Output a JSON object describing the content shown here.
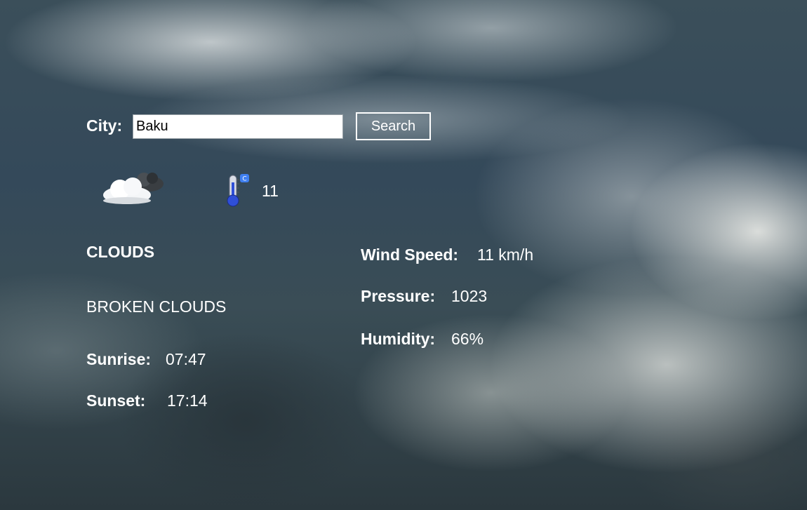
{
  "search": {
    "city_label": "City:",
    "city_value": "Baku",
    "button_label": "Search"
  },
  "current": {
    "weather_icon": "cloud-icon",
    "thermometer_icon": "thermometer-celsius-icon",
    "temperature": "11",
    "main": "CLOUDS",
    "description": "BROKEN CLOUDS"
  },
  "sun": {
    "sunrise_label": "Sunrise:",
    "sunrise_value": "07:47",
    "sunset_label": "Sunset:",
    "sunset_value": "17:14"
  },
  "details": {
    "wind_label": "Wind Speed:",
    "wind_value": "11 km/h",
    "pressure_label": "Pressure:",
    "pressure_value": "1023",
    "humidity_label": "Humidity:",
    "humidity_value": "66%"
  },
  "colors": {
    "text": "#ffffff",
    "thermometer_fill": "#2f4fd8",
    "celsius_badge": "#3f7ff0"
  }
}
